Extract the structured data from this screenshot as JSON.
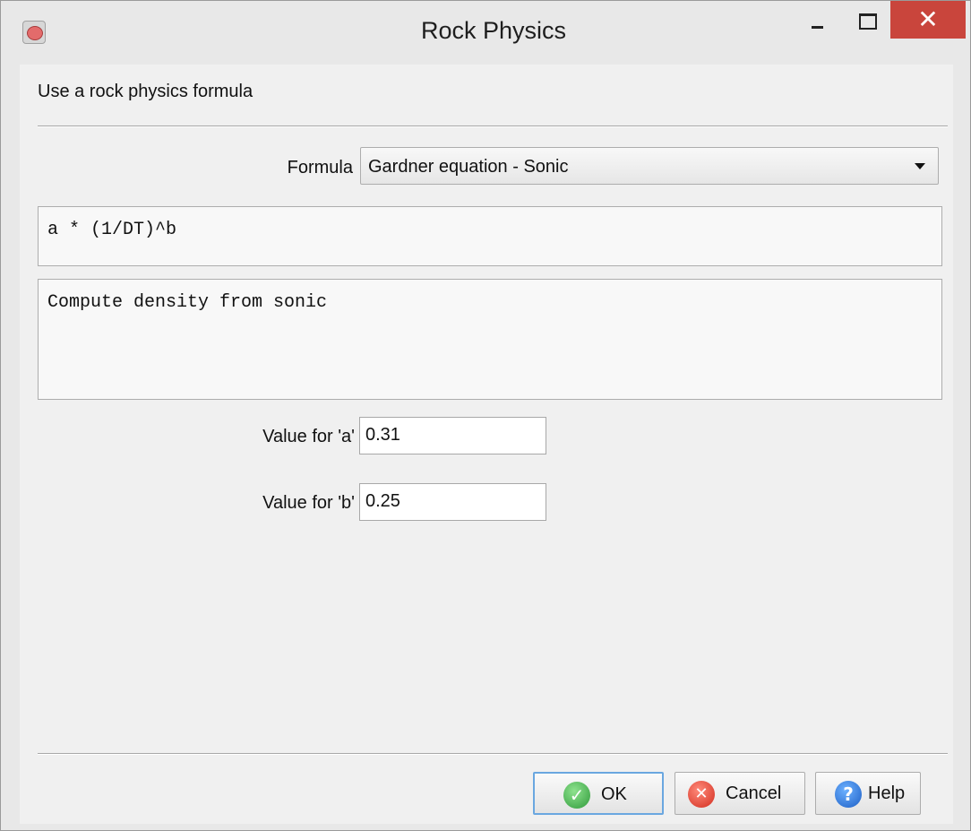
{
  "window": {
    "title": "Rock Physics",
    "close_glyph": "✕"
  },
  "header": {
    "text": "Use a rock physics formula"
  },
  "formula": {
    "label": "Formula",
    "selected": "Gardner equation - Sonic"
  },
  "expression": "a * (1/DT)^b",
  "description": "Compute density from sonic",
  "params": [
    {
      "label": "Value for 'a'",
      "value": "0.31"
    },
    {
      "label": "Value for 'b'",
      "value": "0.25"
    }
  ],
  "buttons": {
    "ok": {
      "label": "OK",
      "icon": "check-icon",
      "glyph": "✓"
    },
    "cancel": {
      "label": "Cancel",
      "icon": "cancel-icon",
      "glyph": "✕"
    },
    "help": {
      "label": "Help",
      "icon": "help-icon",
      "glyph": "?"
    }
  },
  "colors": {
    "close_button": "#c9453c",
    "ok_focus_border": "#6aa7e0"
  }
}
